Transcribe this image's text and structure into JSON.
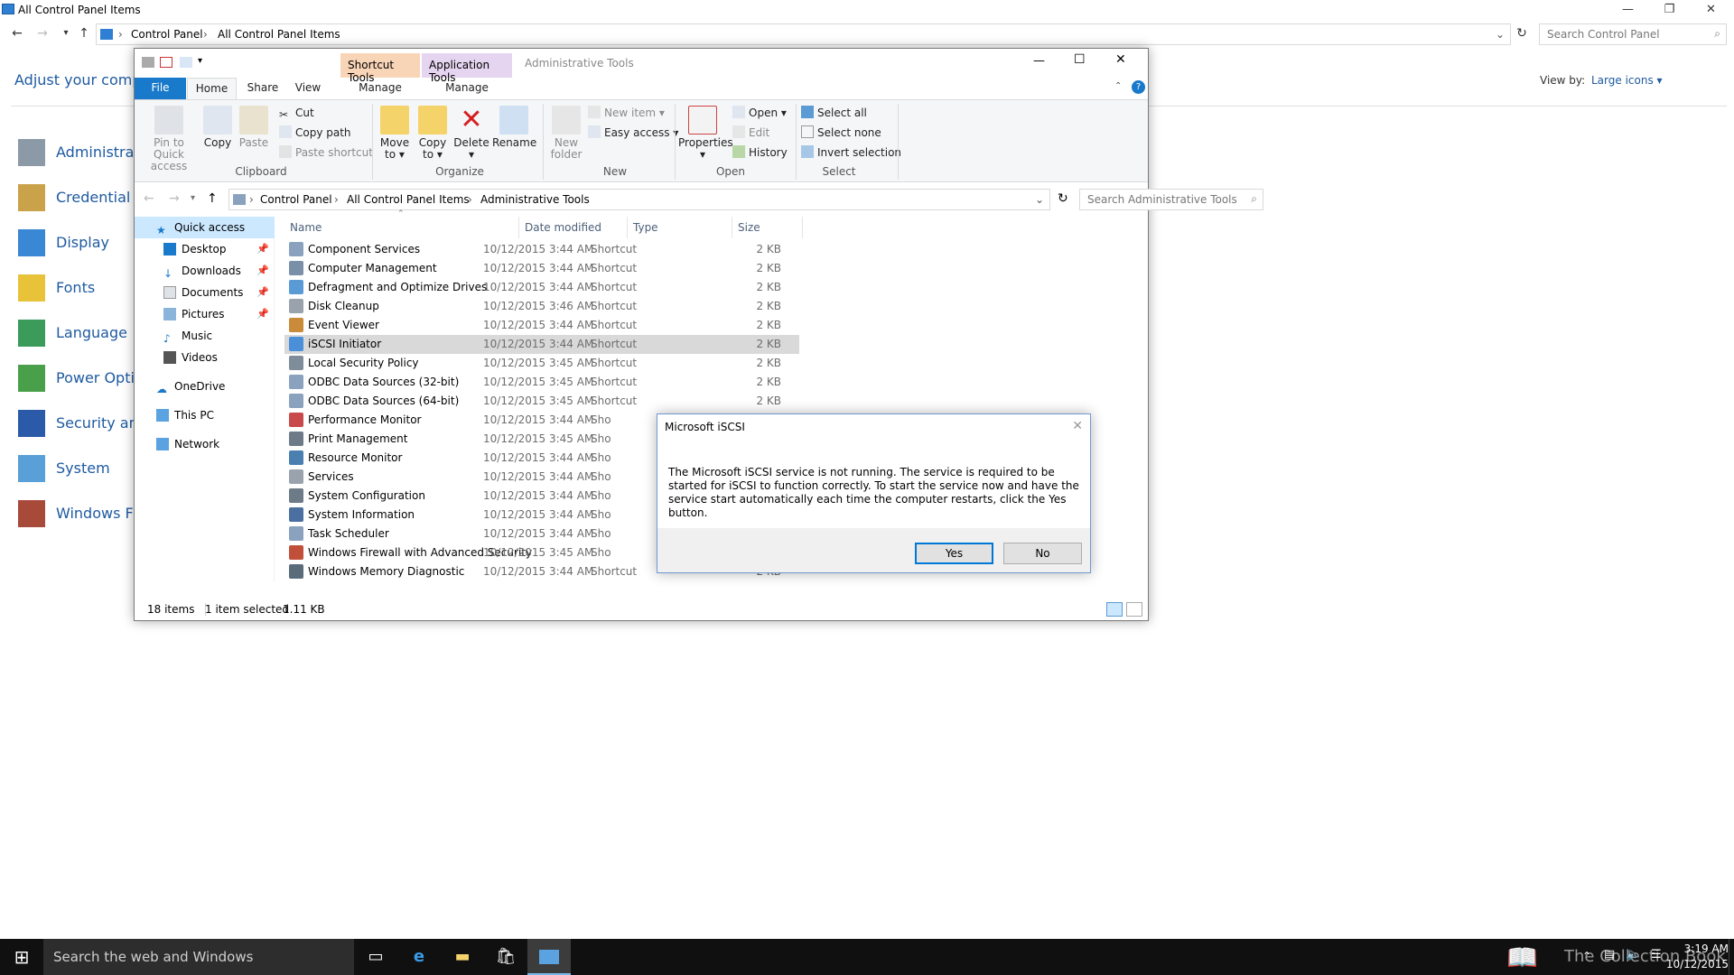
{
  "control_panel": {
    "title": "All Control Panel Items",
    "breadcrumb": [
      "Control Panel",
      "All Control Panel Items"
    ],
    "search_placeholder": "Search Control Panel",
    "heading": "Adjust your compu",
    "view_by_label": "View by:",
    "view_by_value": "Large icons ▾",
    "items": [
      "Administrati",
      "Credential M",
      "Display",
      "Fonts",
      "Language",
      "Power Optio",
      "Security and",
      "System",
      "Windows Fir"
    ]
  },
  "explorer": {
    "title": "Administrative Tools",
    "context_tabs": {
      "shortcut_tools": "Shortcut Tools",
      "application_tools": "Application Tools"
    },
    "tabs": {
      "file": "File",
      "home": "Home",
      "share": "Share",
      "view": "View",
      "manage1": "Manage",
      "manage2": "Manage"
    },
    "ribbon": {
      "pin": "Pin to Quick access",
      "copy": "Copy",
      "paste": "Paste",
      "cut": "Cut",
      "copy_path": "Copy path",
      "paste_shortcut": "Paste shortcut",
      "clipboard": "Clipboard",
      "move_to": "Move to ▾",
      "copy_to": "Copy to ▾",
      "delete": "Delete ▾",
      "rename": "Rename",
      "organize": "Organize",
      "new_item": "New item ▾",
      "easy_access": "Easy access ▾",
      "new_folder": "New folder",
      "new": "New",
      "properties": "Properties ▾",
      "open": "Open ▾",
      "edit": "Edit",
      "history": "History",
      "open_group": "Open",
      "select_all": "Select all",
      "select_none": "Select none",
      "invert_selection": "Invert selection",
      "select_group": "Select"
    },
    "breadcrumb": [
      "Control Panel",
      "All Control Panel Items",
      "Administrative Tools"
    ],
    "search_placeholder": "Search Administrative Tools",
    "nav": {
      "quick_access": "Quick access",
      "desktop": "Desktop",
      "downloads": "Downloads",
      "documents": "Documents",
      "pictures": "Pictures",
      "music": "Music",
      "videos": "Videos",
      "onedrive": "OneDrive",
      "this_pc": "This PC",
      "network": "Network"
    },
    "columns": {
      "name": "Name",
      "date": "Date modified",
      "type": "Type",
      "size": "Size"
    },
    "files": [
      {
        "name": "Component Services",
        "date": "10/12/2015 3:44 AM",
        "type": "Shortcut",
        "size": "2 KB"
      },
      {
        "name": "Computer Management",
        "date": "10/12/2015 3:44 AM",
        "type": "Shortcut",
        "size": "2 KB"
      },
      {
        "name": "Defragment and Optimize Drives",
        "date": "10/12/2015 3:44 AM",
        "type": "Shortcut",
        "size": "2 KB"
      },
      {
        "name": "Disk Cleanup",
        "date": "10/12/2015 3:46 AM",
        "type": "Shortcut",
        "size": "2 KB"
      },
      {
        "name": "Event Viewer",
        "date": "10/12/2015 3:44 AM",
        "type": "Shortcut",
        "size": "2 KB"
      },
      {
        "name": "iSCSI Initiator",
        "date": "10/12/2015 3:44 AM",
        "type": "Shortcut",
        "size": "2 KB"
      },
      {
        "name": "Local Security Policy",
        "date": "10/12/2015 3:45 AM",
        "type": "Shortcut",
        "size": "2 KB"
      },
      {
        "name": "ODBC Data Sources (32-bit)",
        "date": "10/12/2015 3:45 AM",
        "type": "Shortcut",
        "size": "2 KB"
      },
      {
        "name": "ODBC Data Sources (64-bit)",
        "date": "10/12/2015 3:45 AM",
        "type": "Shortcut",
        "size": "2 KB"
      },
      {
        "name": "Performance Monitor",
        "date": "10/12/2015 3:44 AM",
        "type": "Sho",
        "size": ""
      },
      {
        "name": "Print Management",
        "date": "10/12/2015 3:45 AM",
        "type": "Sho",
        "size": ""
      },
      {
        "name": "Resource Monitor",
        "date": "10/12/2015 3:44 AM",
        "type": "Sho",
        "size": ""
      },
      {
        "name": "Services",
        "date": "10/12/2015 3:44 AM",
        "type": "Sho",
        "size": ""
      },
      {
        "name": "System Configuration",
        "date": "10/12/2015 3:44 AM",
        "type": "Sho",
        "size": ""
      },
      {
        "name": "System Information",
        "date": "10/12/2015 3:44 AM",
        "type": "Sho",
        "size": ""
      },
      {
        "name": "Task Scheduler",
        "date": "10/12/2015 3:44 AM",
        "type": "Sho",
        "size": ""
      },
      {
        "name": "Windows Firewall with Advanced Security",
        "date": "10/12/2015 3:45 AM",
        "type": "Sho",
        "size": ""
      },
      {
        "name": "Windows Memory Diagnostic",
        "date": "10/12/2015 3:44 AM",
        "type": "Shortcut",
        "size": "2 KB"
      }
    ],
    "status": {
      "count": "18 items",
      "selected": "1 item selected",
      "size": "1.11 KB"
    }
  },
  "dialog": {
    "title": "Microsoft iSCSI",
    "message": "The Microsoft iSCSI service is not running. The service is required to be started for iSCSI to function correctly. To start the service now and have the service start automatically each time the computer restarts, click the Yes button.",
    "yes": "Yes",
    "no": "No"
  },
  "taskbar": {
    "search_text": "Search the web and Windows",
    "time": "3:19 AM",
    "date": "10/12/2015",
    "watermark": "The Collection Book"
  },
  "colors": {
    "accent": "#0078d7",
    "shortcut_tools": "#f9d5b8",
    "application_tools": "#e6d5f0",
    "selected_row": "#d9d9d9"
  }
}
